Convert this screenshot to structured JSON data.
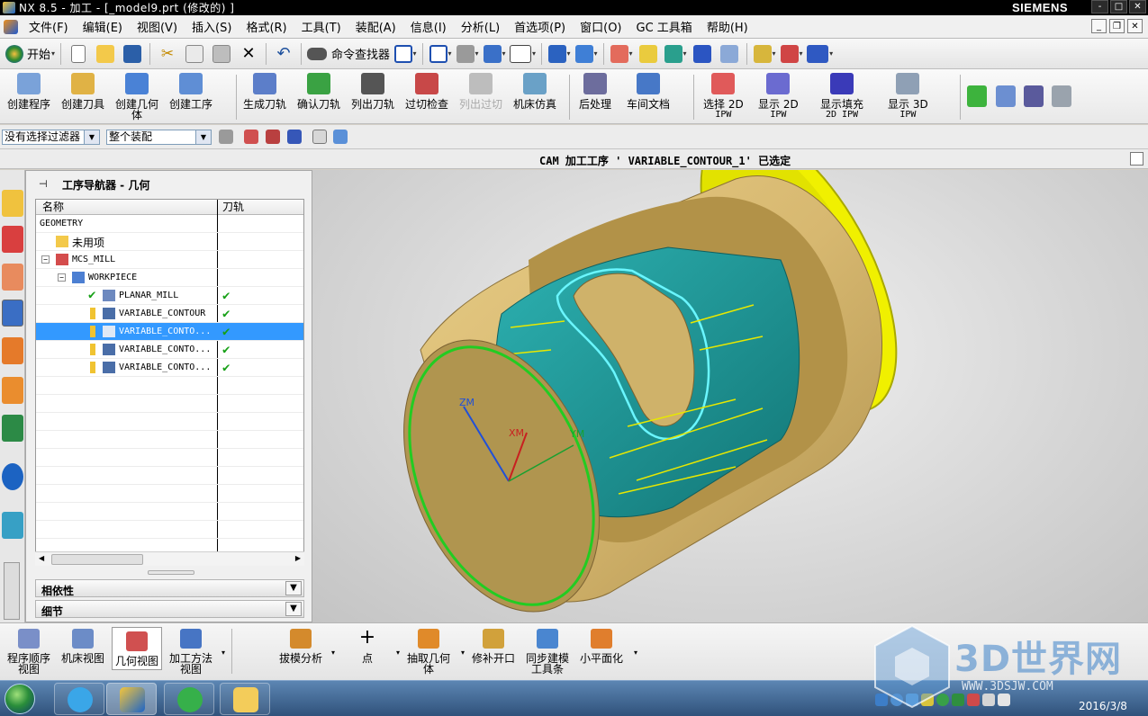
{
  "window": {
    "title": "NX 8.5 - 加工 - [_model9.prt (修改的) ]",
    "brand": "SIEMENS",
    "controls": [
      "-",
      "□",
      "✕"
    ]
  },
  "menu": [
    "文件(F)",
    "编辑(E)",
    "视图(V)",
    "插入(S)",
    "格式(R)",
    "工具(T)",
    "装配(A)",
    "信息(I)",
    "分析(L)",
    "首选项(P)",
    "窗口(O)",
    "GC 工具箱",
    "帮助(H)"
  ],
  "std_toolbar": {
    "start": "开始",
    "command_finder": "命令查找器"
  },
  "ribbon": {
    "buttons": [
      {
        "label": "创建程序"
      },
      {
        "label": "创建刀具"
      },
      {
        "label": "创建几何",
        "label2": "体"
      },
      {
        "label": "创建工序"
      },
      {
        "label": "生成刀轨"
      },
      {
        "label": "确认刀轨"
      },
      {
        "label": "列出刀轨"
      },
      {
        "label": "过切检查"
      },
      {
        "label": "列出过切"
      },
      {
        "label": "机床仿真"
      },
      {
        "label": "后处理"
      },
      {
        "label": "车间文档"
      },
      {
        "label": "选择 2D",
        "label2": "IPW"
      },
      {
        "label": "显示 2D",
        "label2": "IPW"
      },
      {
        "label": "显示填充",
        "label2": "2D IPW"
      },
      {
        "label": "显示 3D",
        "label2": "IPW"
      }
    ]
  },
  "selection_bar": {
    "filter": "没有选择过滤器",
    "scope": "整个装配"
  },
  "status_message": "CAM 加工工序 ' VARIABLE_CONTOUR_1' 已选定",
  "navigator": {
    "title": "工序导航器 - 几何",
    "columns": [
      "名称",
      "刀轨"
    ],
    "rows": [
      {
        "name": "GEOMETRY"
      },
      {
        "name": "未用项"
      },
      {
        "name": "MCS_MILL"
      },
      {
        "name": "WORKPIECE"
      },
      {
        "name": "PLANAR_MILL",
        "toolpath": "✔"
      },
      {
        "name": "VARIABLE_CONTOUR",
        "toolpath": "✔"
      },
      {
        "name": "VARIABLE_CONTO...",
        "toolpath": "✔",
        "selected": true
      },
      {
        "name": "VARIABLE_CONTO...",
        "toolpath": "✔"
      },
      {
        "name": "VARIABLE_CONTO...",
        "toolpath": "✔"
      }
    ],
    "sections": [
      "相依性",
      "细节"
    ]
  },
  "viewport": {
    "axis_labels": {
      "zm": "ZM",
      "ym": "YM",
      "xm": "XM"
    },
    "colors": {
      "body": "#d7b870",
      "face": "#b89c57",
      "slot": "#1d9a9a",
      "end_disc": "#f0f000",
      "circle": "#22cc22"
    }
  },
  "bottom_toolbar": [
    {
      "label": "程序顺序",
      "label2": "视图"
    },
    {
      "label": "机床视图"
    },
    {
      "label": "几何视图",
      "active": true
    },
    {
      "label": "加工方法",
      "label2": "视图"
    },
    {
      "label": "拔模分析"
    },
    {
      "label": "点"
    },
    {
      "label": "抽取几何",
      "label2": "体"
    },
    {
      "label": "修补开口"
    },
    {
      "label": "同步建模",
      "label2": "工具条"
    },
    {
      "label": "小平面化"
    }
  ],
  "watermark": {
    "text": "3D世界网",
    "url": "WWW.3DSJW.COM"
  },
  "taskbar": {
    "date": "2016/3/8"
  }
}
